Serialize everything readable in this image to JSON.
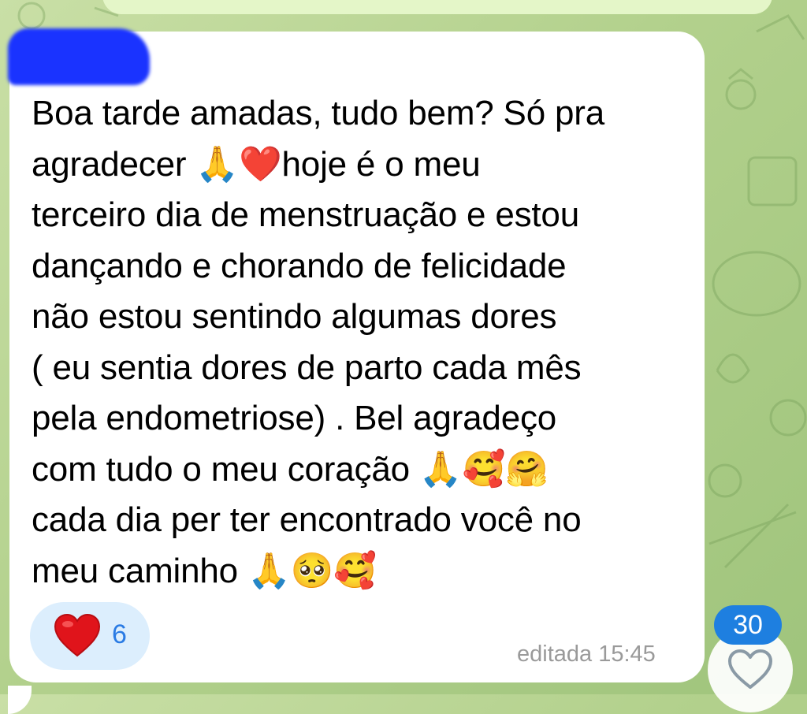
{
  "message": {
    "text": "Boa tarde amadas, tudo bem? Só pra\nagradecer 🙏❤️hoje é o meu\nterceiro dia de menstruação e estou\ndançando e chorando de felicidade\nnão estou sentindo algumas dores\n( eu sentia dores de parto cada mês\npela endometriose) . Bel agradeço\ncom tudo o meu coração 🙏🥰🤗\ncada dia per ter encontrado você no\nmeu caminho 🙏🥺🥰",
    "timestamp": "editada 15:45"
  },
  "reaction": {
    "icon": "heart-icon",
    "count": "6",
    "color": "#e0141b"
  },
  "sidebar": {
    "badge_count": "30",
    "fab_icon": "heart-outline-icon"
  },
  "colors": {
    "bubble": "#ffffff",
    "accent": "#1e7fe0",
    "reaction_bg": "#dceefd",
    "timestamp": "#9a9a9a"
  }
}
